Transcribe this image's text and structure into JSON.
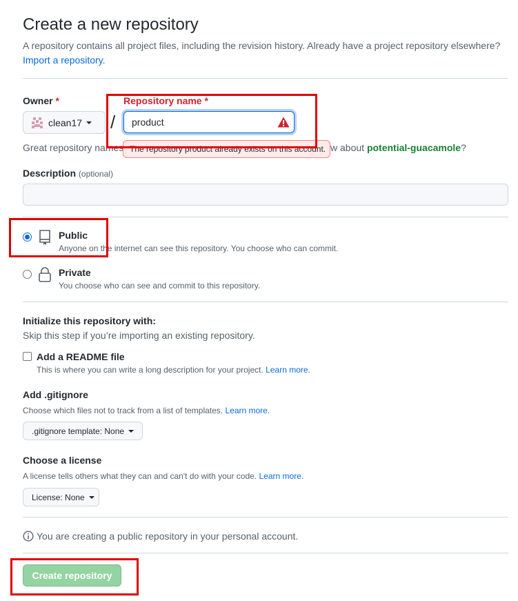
{
  "header": {
    "title": "Create a new repository",
    "subtitle": "A repository contains all project files, including the revision history. Already have a project repository elsewhere?",
    "import_link": "Import a repository."
  },
  "owner": {
    "label": "Owner",
    "required_mark": "*",
    "value": "clean17"
  },
  "repo_name": {
    "label": "Repository name",
    "required_mark": "*",
    "value": "product",
    "error": "The repository product already exists on this account."
  },
  "separator": "/",
  "hint": {
    "prefix": "Great repository names",
    "suffix": "w about",
    "suggestion": "potential-guacamole",
    "end": "?"
  },
  "description": {
    "label": "Description",
    "optional": "(optional)",
    "value": ""
  },
  "visibility": {
    "public": {
      "title": "Public",
      "desc": "Anyone on the internet can see this repository. You choose who can commit.",
      "checked": true
    },
    "private": {
      "title": "Private",
      "desc": "You choose who can see and commit to this repository.",
      "checked": false
    }
  },
  "init": {
    "title": "Initialize this repository with:",
    "subtitle": "Skip this step if you’re importing an existing repository.",
    "readme": {
      "label": "Add a README file",
      "desc": "This is where you can write a long description for your project.",
      "learn_more": "Learn more."
    }
  },
  "gitignore": {
    "title": "Add .gitignore",
    "desc": "Choose which files not to track from a list of templates.",
    "learn_more": "Learn more.",
    "select_label": ".gitignore template: None"
  },
  "license": {
    "title": "Choose a license",
    "desc": "A license tells others what they can and can't do with your code.",
    "learn_more": "Learn more.",
    "select_label": "License: None"
  },
  "info": {
    "text": "You are creating a public repository in your personal account."
  },
  "submit": {
    "label": "Create repository"
  },
  "colors": {
    "accent": "#0969da",
    "error": "#cf222e",
    "success": "#1a7f37",
    "create_button": "#94d3a2",
    "annotation_box": "#e00000"
  },
  "icons": {
    "owner_avatar": "identicon-avatar",
    "warning": "alert-triangle-icon",
    "public": "repo-icon",
    "private": "lock-icon",
    "info": "info-icon"
  }
}
